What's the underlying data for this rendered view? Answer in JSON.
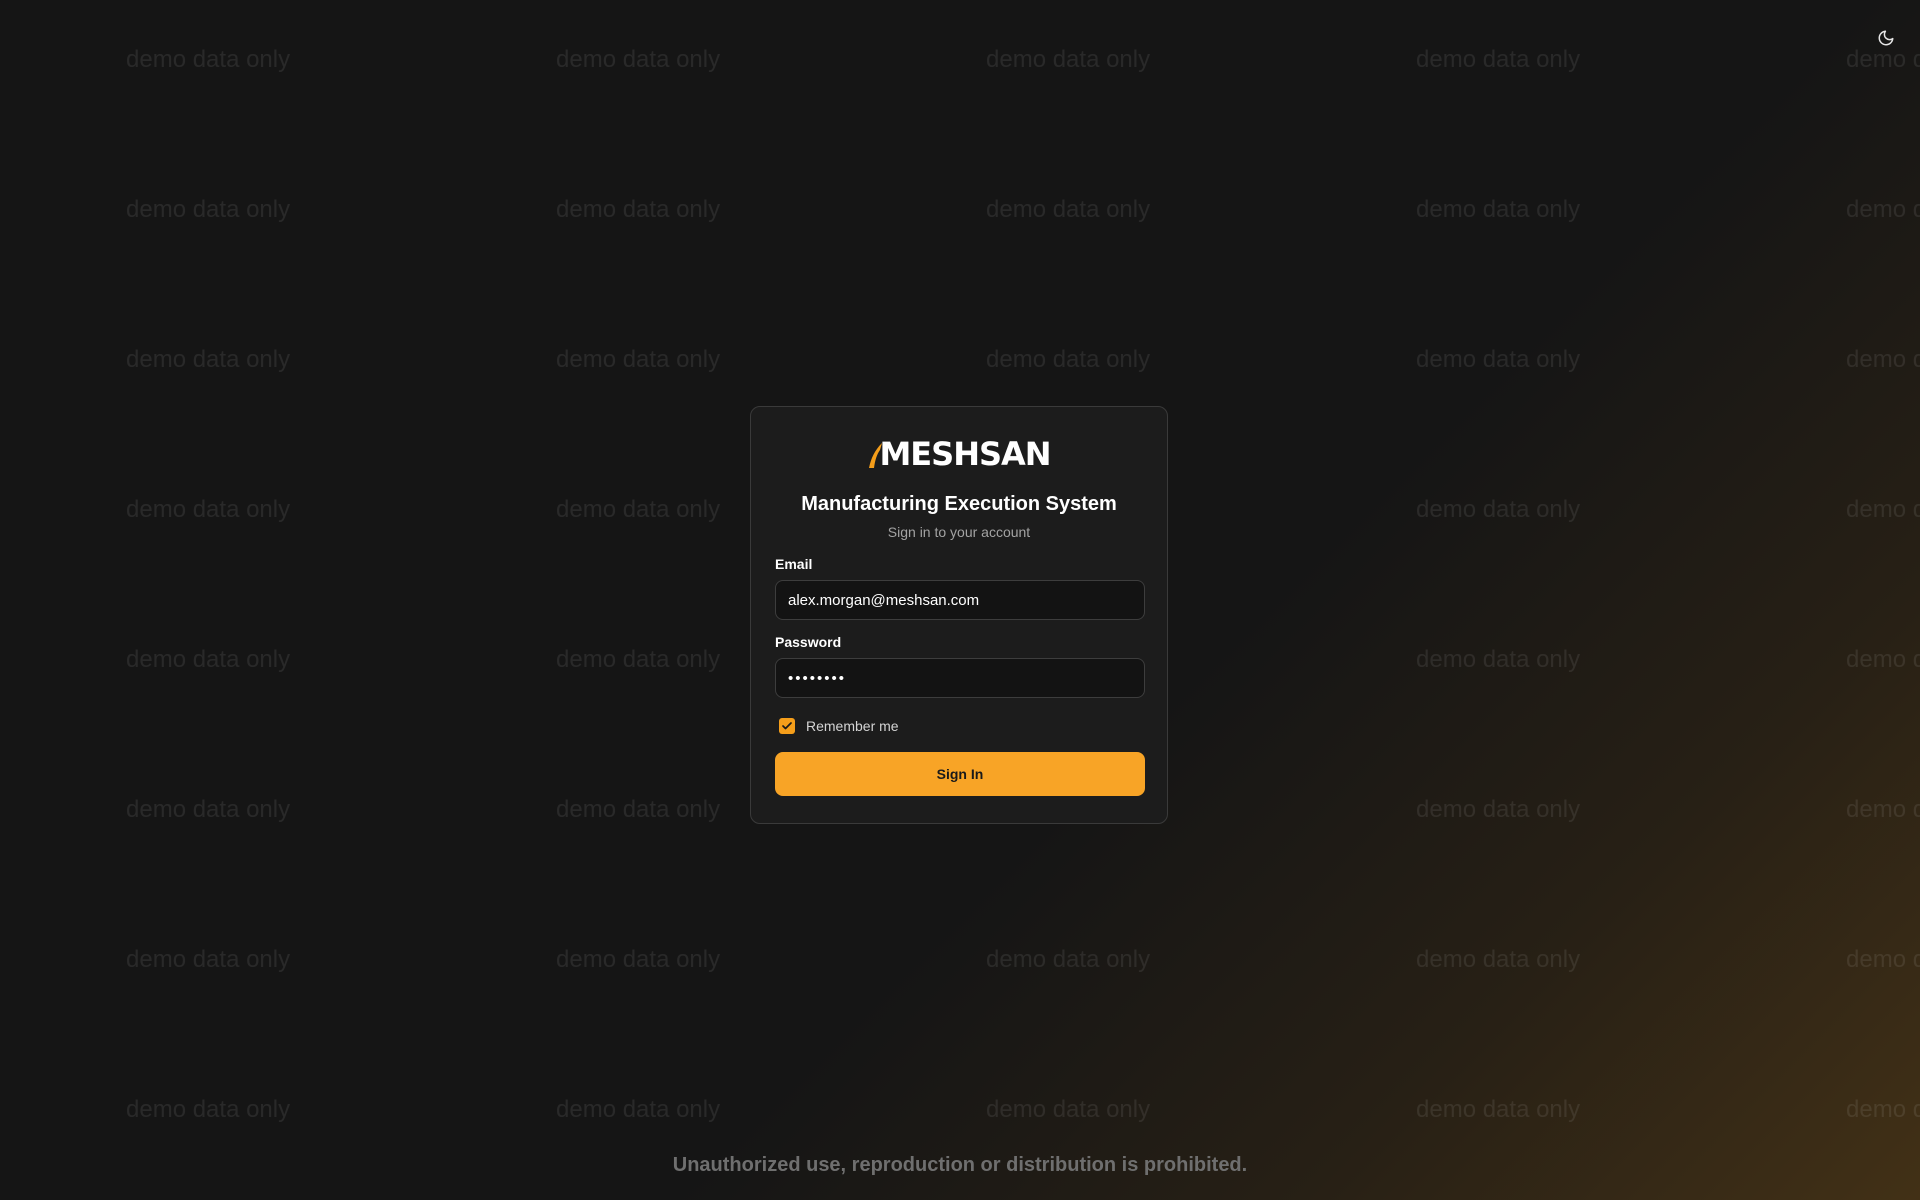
{
  "watermark": {
    "text": "demo data only"
  },
  "theme_toggle": {
    "icon": "moon-icon"
  },
  "login": {
    "brand": "MESHSAN",
    "title": "Manufacturing Execution System",
    "subtitle": "Sign in to your account",
    "email_label": "Email",
    "email_value": "alex.morgan@meshsan.com",
    "password_label": "Password",
    "password_value": "••••••••",
    "remember_label": "Remember me",
    "remember_checked": true,
    "sign_in_label": "Sign In"
  },
  "footer": {
    "notice": "Unauthorized use, reproduction or distribution is prohibited."
  },
  "colors": {
    "accent": "#f8a426",
    "background": "#151515",
    "card": "#1c1c1c"
  }
}
